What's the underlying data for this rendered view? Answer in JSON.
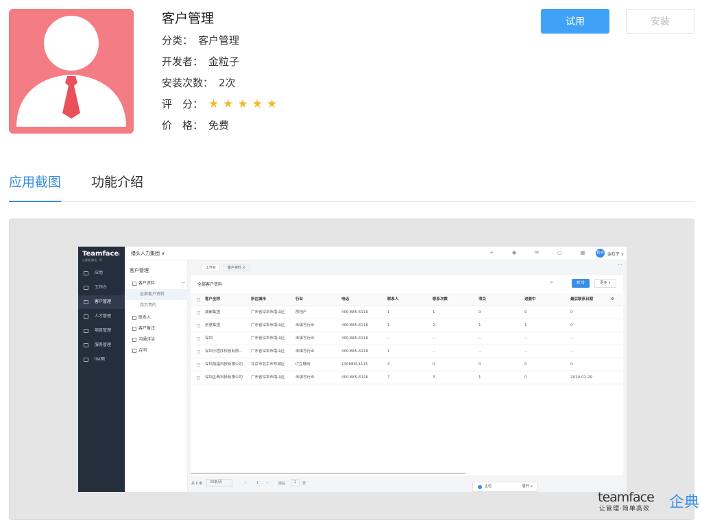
{
  "app": {
    "title": "客户管理",
    "icon": "user-avatar-icon",
    "icon_bg": "#f47c85",
    "category_label": "分类：",
    "category": "客户管理",
    "developer_label": "开发者：",
    "developer": "金粒子",
    "installs_label": "安装次数：",
    "installs": "2次",
    "rating_label": "评　分：",
    "rating": 5,
    "rating_max": 5,
    "stars": "★★★★★",
    "price_label": "价　格：",
    "price": "免费"
  },
  "buttons": {
    "try": "试用",
    "install": "安装"
  },
  "colors": {
    "accent": "#3a8ee6",
    "try_button": "#3fa2f7",
    "star": "#f5b82e"
  },
  "tabs": [
    {
      "label": "应用截图",
      "active": true
    },
    {
      "label": "功能介绍",
      "active": false
    }
  ],
  "screenshot": {
    "brand": "Teamface",
    "slogan": "让数据·触达一切",
    "company": "猎头人力集团 ∨",
    "user": {
      "avatar": "粒子",
      "name": "金粒子 ∨"
    },
    "top_icons": "+ ◆ ✉ ○ ▦",
    "sidebar": [
      "应用",
      "工作台",
      "客户管理",
      "人才管理",
      "项目管理",
      "服务管理",
      "list图"
    ],
    "subnav": {
      "header": "客户管理",
      "items": [
        "客户资料",
        "全部客户资料",
        "我负责的",
        "联系人",
        "客户备注",
        "沟通详洽",
        "合同"
      ],
      "more": "···"
    },
    "page_tabs": [
      "工作台",
      "客户资料 ×"
    ],
    "panel_more": "···",
    "card_title": "全部客户资料",
    "new_btn": "新 增",
    "more_btn": "更多 ∨",
    "columns": [
      "客户全称",
      "所在城市",
      "行业",
      "电话",
      "联系人",
      "联系次数",
      "项目",
      "进展中",
      "最后联系日期"
    ],
    "rows": [
      [
        "成都集团",
        "广东省深圳市南山区",
        "房地产",
        "400-885-6116",
        "1",
        "1",
        "0",
        "0",
        "0"
      ],
      [
        "创意集团",
        "广东省深圳市南山区",
        "未填写行业",
        "400-885-6116",
        "1",
        "2",
        "1",
        "1",
        "0"
      ],
      [
        "深圳",
        "广东省深圳市南山区",
        "未填写行业",
        "400-885-6116",
        "--",
        "--",
        "--",
        "--",
        "--"
      ],
      [
        "深圳小程序科技有限...",
        "广东省深圳市南山区",
        "未填写行业",
        "400-885-6116",
        "1",
        "--",
        "--",
        "--",
        "--"
      ],
      [
        "深圳加福科技有限公司",
        "北京市北京市东城区",
        "IT互联网",
        "13088811115",
        "4",
        "0",
        "0",
        "0",
        "0"
      ],
      [
        "深圳企典科技有限公司",
        "广东省深圳市南山区",
        "未填写行业",
        "400-885-6116",
        "7",
        "3",
        "1",
        "0",
        "2019-01-29"
      ]
    ],
    "pager": {
      "total": "共 6 条",
      "page_size": "20条/页",
      "current": "1",
      "goto_label": "前往",
      "goto": "1",
      "page_unit": "页"
    },
    "chat": {
      "name": "企信",
      "expand": "展开 ∨"
    }
  },
  "watermark": {
    "brand": "teamface",
    "slogan": "让管理·简单高效",
    "cn": "企典"
  }
}
